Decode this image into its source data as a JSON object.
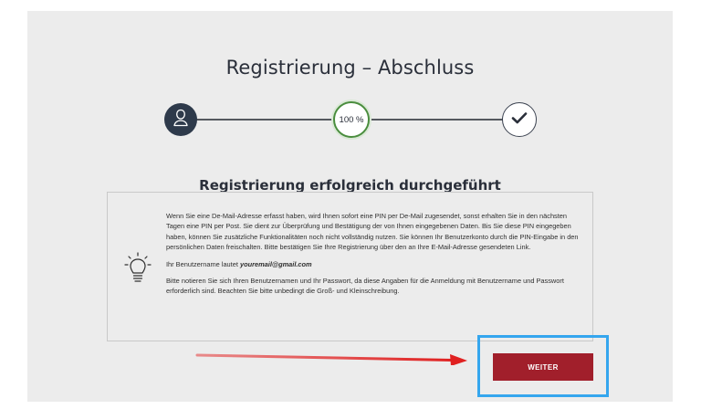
{
  "page": {
    "title": "Registrierung – Abschluss",
    "subtitle": "Registrierung erfolgreich durchgeführt"
  },
  "steps": [
    {
      "icon": "user-icon",
      "state": "done"
    },
    {
      "icon": "progress",
      "label": "100 %",
      "progress_percent": 100
    },
    {
      "icon": "checkmark-icon",
      "state": "done"
    }
  ],
  "info": {
    "icon": "lightbulb-icon",
    "paragraph1": "Wenn Sie eine De-Mail-Adresse erfasst haben, wird Ihnen sofort eine PIN per De-Mail zugesendet, sonst erhalten Sie in den nächsten Tagen eine PIN per Post. Sie dient zur Überprüfung und Bestätigung der von Ihnen eingegebenen Daten. Bis Sie diese PIN eingegeben haben, können Sie zusätzliche Funktionalitäten noch nicht vollständig nutzen. Sie können Ihr Benutzerkonto durch die PIN-Eingabe in den persönlichen Daten freischalten. Bitte bestätigen Sie Ihre Registrierung über den an Ihre E-Mail-Adresse gesendeten Link.",
    "username_prefix": "Ihr Benutzername lautet",
    "username": "youremail@gmail.com",
    "paragraph3": "Bitte notieren Sie sich Ihren Benutzernamen und Ihr Passwort, da diese Angaben für die Anmeldung mit Benutzername und Passwort erforderlich sind. Beachten Sie bitte unbedingt die Groß- und Kleinschreibung."
  },
  "actions": {
    "weiter_label": "WEITER"
  },
  "colors": {
    "background": "#ececec",
    "button": "#a11f2b",
    "progress_ring": "#4a8d3e",
    "step_dark": "#2e3a4b",
    "annotation_arrow": "#e02020",
    "annotation_box": "#35a6ee"
  }
}
